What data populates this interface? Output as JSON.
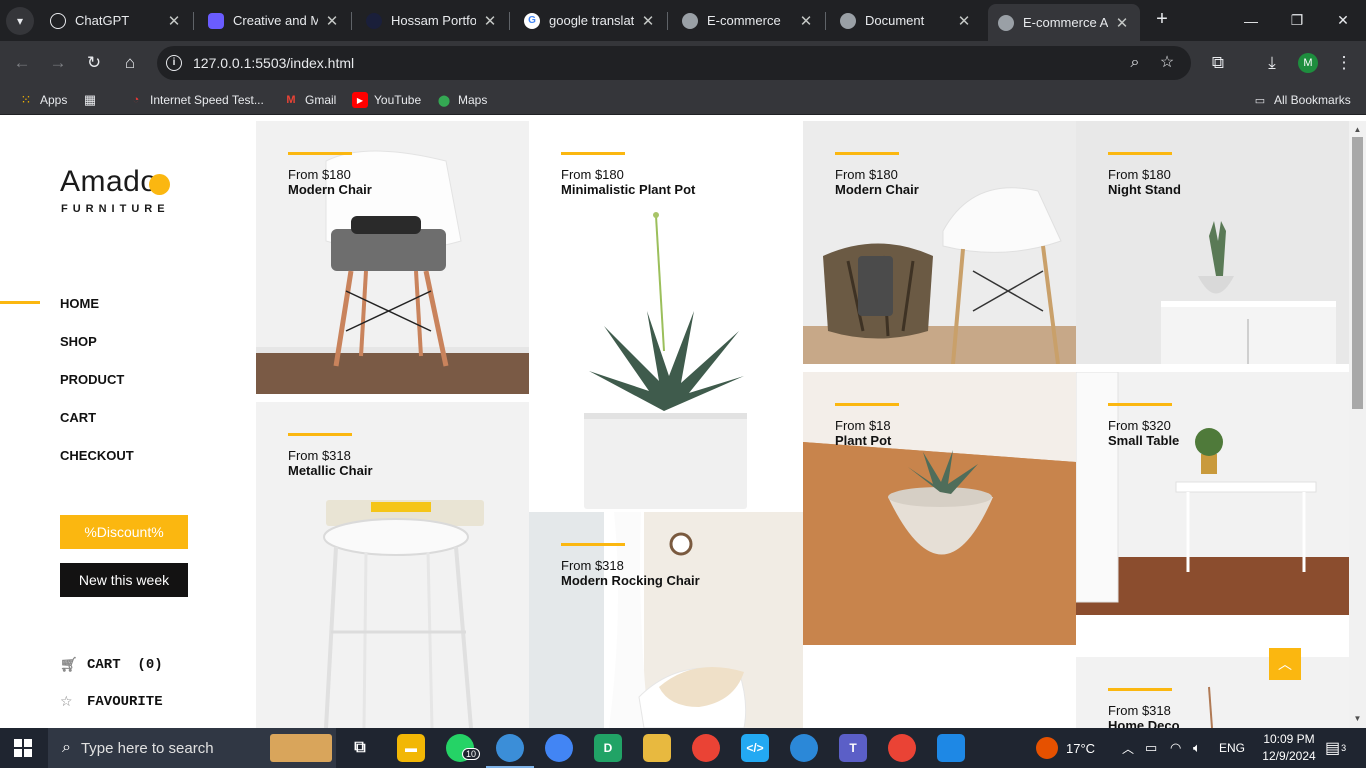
{
  "browser": {
    "tabs": [
      {
        "title": "ChatGPT",
        "favicon": "chatgpt-icon"
      },
      {
        "title": "Creative and Mi",
        "favicon": "copilot-icon"
      },
      {
        "title": "Hossam Portfoli",
        "favicon": "portfolio-icon"
      },
      {
        "title": "google translate",
        "favicon": "google-icon"
      },
      {
        "title": "E-commerce",
        "favicon": "globe-icon"
      },
      {
        "title": "Document",
        "favicon": "globe-icon"
      },
      {
        "title": "E-commerce Am",
        "favicon": "globe-icon",
        "active": true
      }
    ],
    "url": "127.0.0.1:5503/index.html",
    "profile_initial": "M",
    "bookmarks": [
      "Apps",
      "Internet Speed Test...",
      "Gmail",
      "YouTube",
      "Maps"
    ],
    "all_bookmarks": "All Bookmarks"
  },
  "brand": {
    "logo_text": "Amado",
    "tagline": "FURNITURE",
    "accent": "#fbb710"
  },
  "nav": {
    "items": [
      "HOME",
      "SHOP",
      "PRODUCT",
      "CART",
      "CHECKOUT"
    ],
    "active": "HOME"
  },
  "buttons": {
    "discount": "%Discount%",
    "new_week": "New this week"
  },
  "meta": {
    "cart_label": "CART",
    "cart_count": "(0)",
    "favourite_label": "FAVOURITE"
  },
  "products": [
    {
      "price": "From $180",
      "name": "Modern Chair"
    },
    {
      "price": "From $318",
      "name": "Metallic Chair"
    },
    {
      "price": "From $180",
      "name": "Minimalistic Plant Pot"
    },
    {
      "price": "From $318",
      "name": "Modern Rocking Chair"
    },
    {
      "price": "From $180",
      "name": "Modern Chair"
    },
    {
      "price": "From $18",
      "name": "Plant Pot"
    },
    {
      "price": "From $180",
      "name": "Night Stand"
    },
    {
      "price": "From $320",
      "name": "Small Table"
    },
    {
      "price": "From $318",
      "name": "Home Deco"
    }
  ],
  "taskbar": {
    "search_placeholder": "Type here to search",
    "weather": "17°C",
    "language": "ENG",
    "time": "10:09 PM",
    "date": "12/9/2024",
    "whatsapp_badge": "10",
    "notification_count": "3"
  }
}
